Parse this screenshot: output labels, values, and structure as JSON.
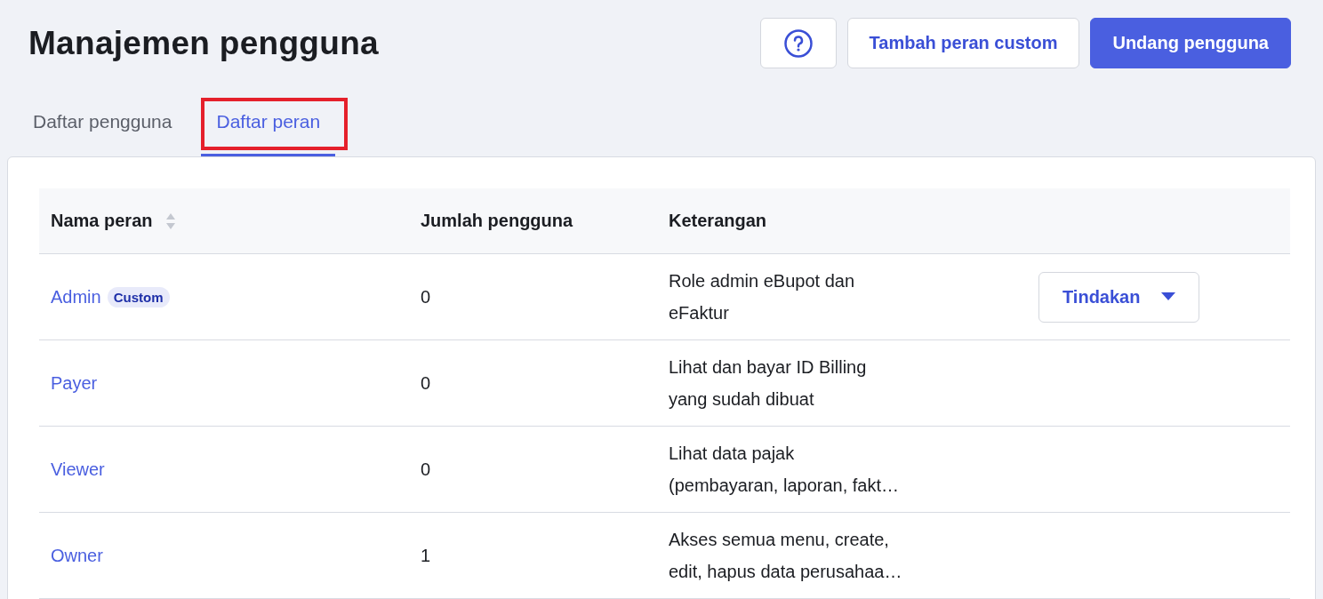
{
  "page": {
    "title": "Manajemen pengguna"
  },
  "buttons": [
    {
      "kind": "help"
    },
    {
      "kind": "secondary",
      "label": "Tambah peran custom"
    },
    {
      "kind": "primary",
      "label": "Undang pengguna"
    }
  ],
  "tabs": [
    {
      "label": "Daftar pengguna",
      "selected": false,
      "highlighted": false
    },
    {
      "label": "Daftar peran",
      "selected": true,
      "highlighted": true
    }
  ],
  "table": {
    "columns": [
      {
        "label": "Nama peran",
        "sortable": true
      },
      {
        "label": "Jumlah pengguna",
        "sortable": false
      },
      {
        "label": "Keterangan",
        "sortable": false
      }
    ],
    "rows": [
      {
        "name": "Admin",
        "badge": "Custom",
        "count": "0",
        "description_lines": [
          "Role admin eBupot dan",
          "eFaktur"
        ],
        "action": "Tindakan"
      },
      {
        "name": "Payer",
        "count": "0",
        "description_lines": [
          "Lihat dan bayar ID Billing",
          "yang sudah dibuat"
        ]
      },
      {
        "name": "Viewer",
        "count": "0",
        "description_lines": [
          "Lihat data pajak",
          "(pembayaran, laporan, fakt…"
        ]
      },
      {
        "name": "Owner",
        "count": "1",
        "description_lines": [
          "Akses semua menu, create,",
          "edit, hapus data perusahaa…"
        ]
      }
    ]
  }
}
